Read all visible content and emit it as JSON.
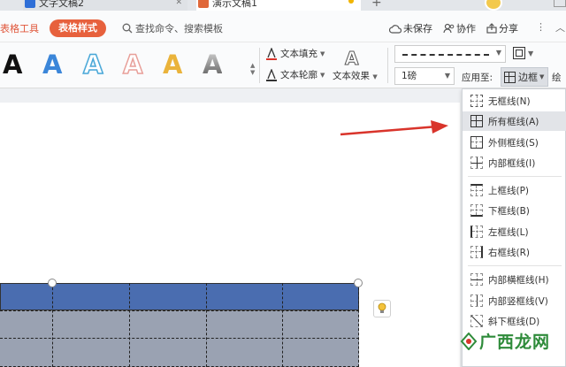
{
  "tabs": [
    {
      "label": "文字文稿2"
    },
    {
      "label": "演示文稿1"
    }
  ],
  "toolbar": {
    "table_tools": "表格工具",
    "table_style": "表格样式",
    "search_placeholder": "查找命令、搜索模板",
    "unsaved": "未保存",
    "collab": "协作",
    "share": "分享"
  },
  "ribbon": {
    "letter": "A",
    "text_fill": "文本填充",
    "text_outline": "文本轮廓",
    "text_effect": "文本效果",
    "line_weight": "1磅",
    "apply_to": "应用至:",
    "border_label": "边框",
    "draw_label": "绘"
  },
  "border_menu": {
    "items": [
      {
        "label": "无框线(N)",
        "icon": "no-border-icon"
      },
      {
        "label": "所有框线(A)",
        "icon": "all-borders-icon"
      },
      {
        "label": "外侧框线(S)",
        "icon": "outside-borders-icon"
      },
      {
        "label": "内部框线(I)",
        "icon": "inside-borders-icon"
      },
      {
        "label": "上框线(P)",
        "icon": "top-border-icon"
      },
      {
        "label": "下框线(B)",
        "icon": "bottom-border-icon"
      },
      {
        "label": "左框线(L)",
        "icon": "left-border-icon"
      },
      {
        "label": "右框线(R)",
        "icon": "right-border-icon"
      },
      {
        "label": "内部横框线(H)",
        "icon": "inside-horizontal-border-icon"
      },
      {
        "label": "内部竖框线(V)",
        "icon": "inside-vertical-border-icon"
      },
      {
        "label": "斜下框线(D)",
        "icon": "diagonal-down-border-icon"
      }
    ],
    "active_index": 1
  },
  "watermark": {
    "text": "广西龙网"
  },
  "colors": {
    "accent": "#e7613d",
    "table_header": "#4a6db0",
    "table_body": "#9aa2b2",
    "arrow": "#d9342b"
  }
}
